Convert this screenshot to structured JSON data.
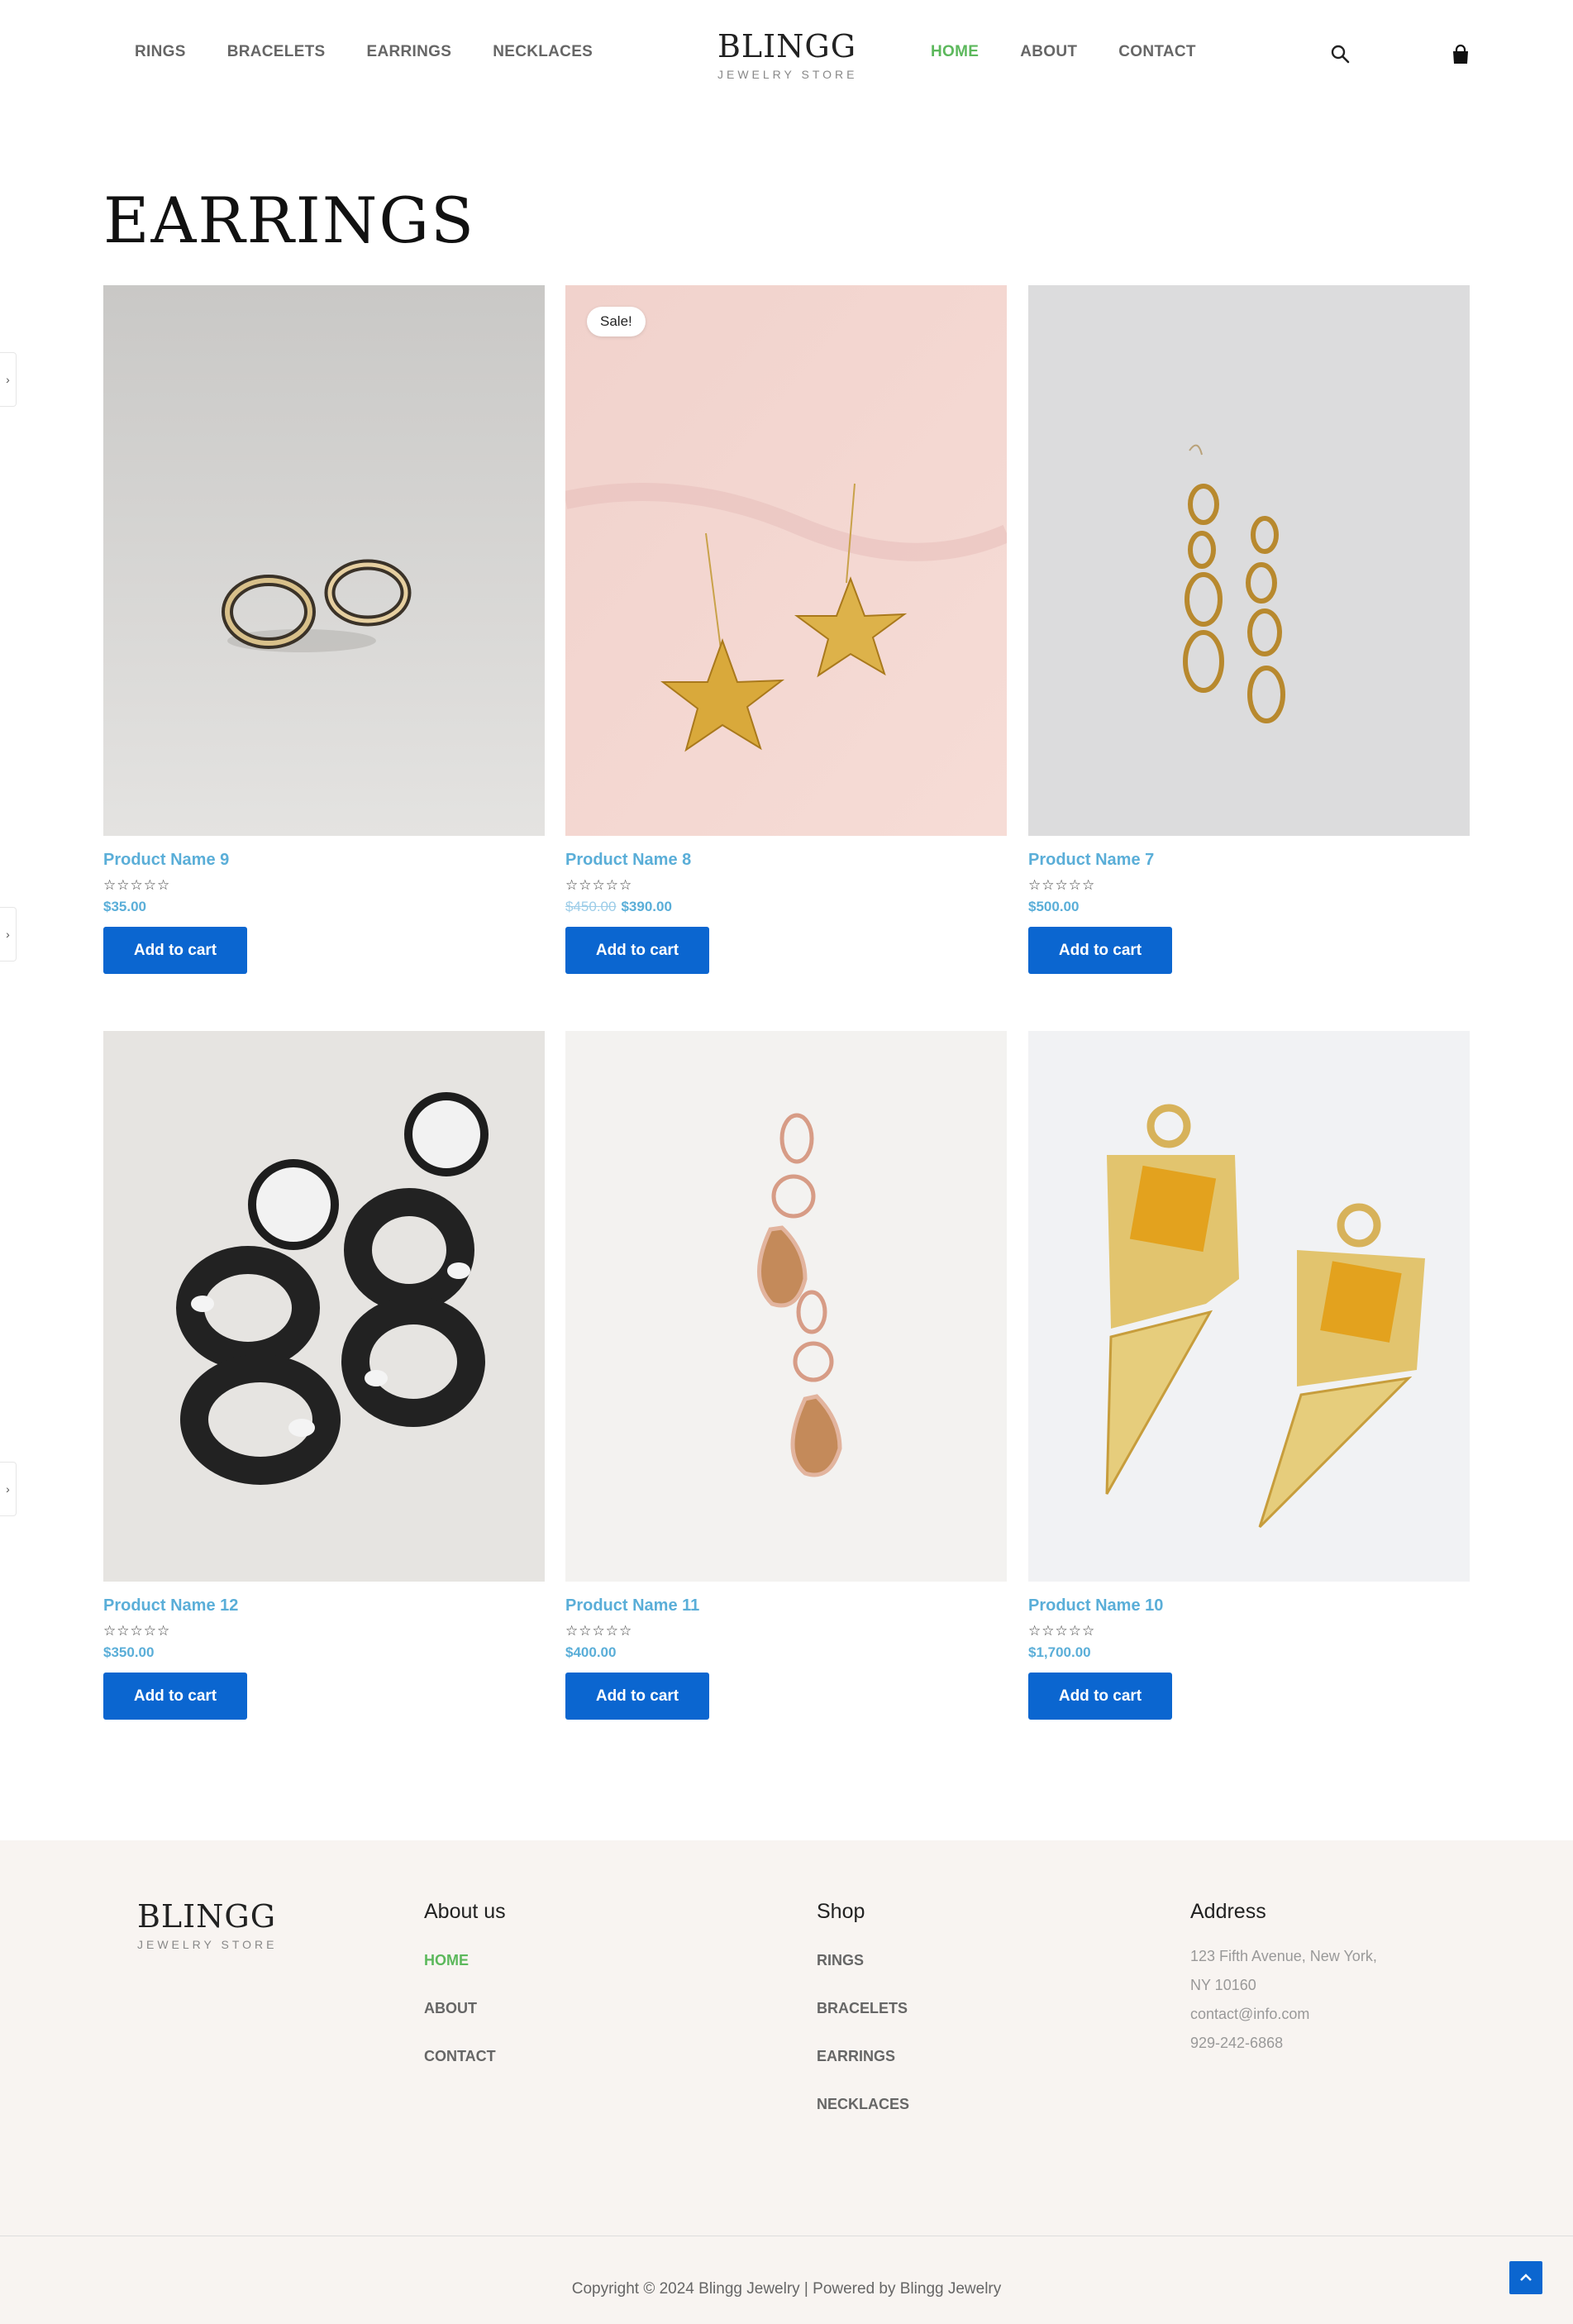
{
  "header": {
    "nav_left": [
      "RINGS",
      "BRACELETS",
      "EARRINGS",
      "NECKLACES"
    ],
    "nav_right": [
      "HOME",
      "ABOUT",
      "CONTACT"
    ],
    "active_nav": "HOME",
    "logo_title": "BLINGG",
    "logo_subtitle": "JEWELRY STORE",
    "search_icon": "search-icon",
    "cart_icon": "shopping-bag-icon"
  },
  "page_title": "EARRINGS",
  "products": [
    {
      "name": "Product Name 9",
      "rating": "☆☆☆☆☆",
      "price": "$35.00",
      "old_price": "",
      "sale": "",
      "button": "Add to cart"
    },
    {
      "name": "Product Name 8",
      "rating": "☆☆☆☆☆",
      "price": "$390.00",
      "old_price": "$450.00",
      "sale": "Sale!",
      "button": "Add to cart"
    },
    {
      "name": "Product Name 7",
      "rating": "☆☆☆☆☆",
      "price": "$500.00",
      "old_price": "",
      "sale": "",
      "button": "Add to cart"
    },
    {
      "name": "Product Name 12",
      "rating": "☆☆☆☆☆",
      "price": "$350.00",
      "old_price": "",
      "sale": "",
      "button": "Add to cart"
    },
    {
      "name": "Product Name 11",
      "rating": "☆☆☆☆☆",
      "price": "$400.00",
      "old_price": "",
      "sale": "",
      "button": "Add to cart"
    },
    {
      "name": "Product Name 10",
      "rating": "☆☆☆☆☆",
      "price": "$1,700.00",
      "old_price": "",
      "sale": "",
      "button": "Add to cart"
    }
  ],
  "footer": {
    "logo_title": "BLINGG",
    "logo_subtitle": "JEWELRY STORE",
    "about_title": "About us",
    "about_links": [
      "HOME",
      "ABOUT",
      "CONTACT"
    ],
    "shop_title": "Shop",
    "shop_links": [
      "RINGS",
      "BRACELETS",
      "EARRINGS",
      "NECKLACES"
    ],
    "address_title": "Address",
    "address_line1": "123 Fifth Avenue, New York,",
    "address_line2": "NY 10160",
    "email": "contact@info.com",
    "phone": "929-242-6868",
    "copyright": "Copyright © 2024 Blingg Jewelry | Powered by Blingg Jewelry"
  },
  "colors": {
    "accent_green": "#5cb85c",
    "link_blue": "#5aaed8",
    "button_blue": "#0b66d0",
    "footer_bg": "#f8f4f1"
  },
  "side_tab_icon": "chevron-right-icon",
  "back_to_top_icon": "chevron-up-icon"
}
